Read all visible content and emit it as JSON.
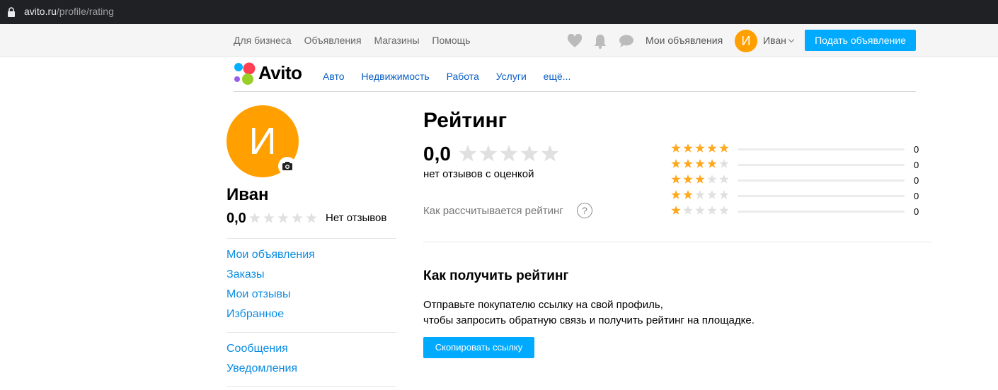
{
  "browser": {
    "url_host": "avito.ru",
    "url_path": "/profile/rating"
  },
  "header": {
    "nav": [
      "Для бизнеса",
      "Объявления",
      "Магазины",
      "Помощь"
    ],
    "my_ads": "Мои объявления",
    "avatar_letter": "И",
    "user_name": "Иван",
    "post_button": "Подать объявление"
  },
  "brand": {
    "logo_text": "Avito"
  },
  "categories": [
    "Авто",
    "Недвижимость",
    "Работа",
    "Услуги",
    "ещё..."
  ],
  "profile": {
    "avatar_letter": "И",
    "name": "Иван",
    "rating": "0,0",
    "stars_filled": 0,
    "reviews_text": "Нет отзывов"
  },
  "sidebar": {
    "group1": [
      "Мои объявления",
      "Заказы",
      "Мои отзывы",
      "Избранное"
    ],
    "group2": [
      "Сообщения",
      "Уведомления"
    ]
  },
  "rating": {
    "title": "Рейтинг",
    "value": "0,0",
    "stars_filled": 0,
    "no_reviews": "нет отзывов с оценкой",
    "how_calculated": "Как рассчитывается рейтинг",
    "distribution": [
      {
        "stars": 5,
        "count": "0"
      },
      {
        "stars": 4,
        "count": "0"
      },
      {
        "stars": 3,
        "count": "0"
      },
      {
        "stars": 2,
        "count": "0"
      },
      {
        "stars": 1,
        "count": "0"
      }
    ]
  },
  "how_to_get": {
    "title": "Как получить рейтинг",
    "line1": "Отправьте покупателю ссылку на свой профиль,",
    "line2": "чтобы запросить обратную связь и получить рейтинг на площадке.",
    "button": "Скопировать ссылку"
  },
  "colors": {
    "accent": "#00aaff",
    "link": "#0a8ce3",
    "avatar": "#ff9f00",
    "star_on": "#ffa820",
    "star_off": "#e0e0e0"
  }
}
